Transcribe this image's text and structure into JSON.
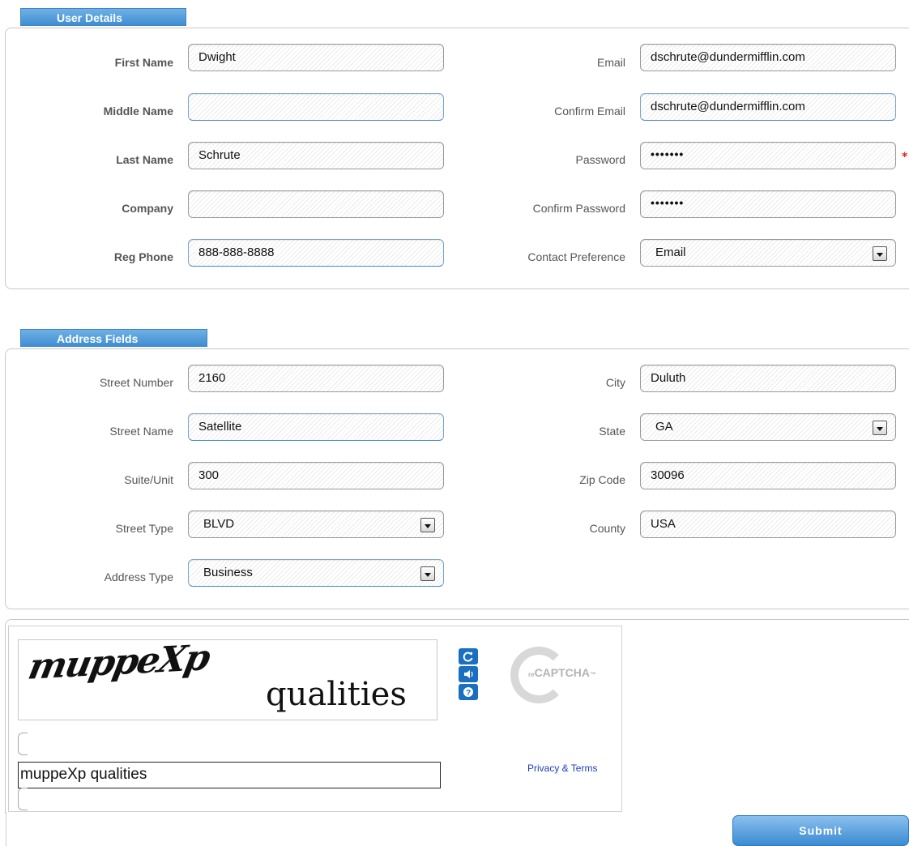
{
  "user_details": {
    "title": "User Details",
    "first_name": {
      "label": "First Name",
      "value": "Dwight"
    },
    "middle_name": {
      "label": "Middle Name",
      "value": ""
    },
    "last_name": {
      "label": "Last Name",
      "value": "Schrute"
    },
    "company": {
      "label": "Company",
      "value": ""
    },
    "reg_phone": {
      "label": "Reg Phone",
      "value": "888-888-8888"
    },
    "email": {
      "label": "Email",
      "value": "dschrute@dundermifflin.com"
    },
    "confirm_email": {
      "label": "Confirm Email",
      "value": "dschrute@dundermifflin.com"
    },
    "password": {
      "label": "Password",
      "value": "•••••••",
      "required_mark": "*"
    },
    "confirm_password": {
      "label": "Confirm Password",
      "value": "•••••••"
    },
    "contact_preference": {
      "label": "Contact Preference",
      "value": "Email"
    }
  },
  "address_fields": {
    "title": "Address Fields",
    "street_number": {
      "label": "Street Number",
      "value": "2160"
    },
    "street_name": {
      "label": "Street Name",
      "value": "Satellite"
    },
    "suite_unit": {
      "label": "Suite/Unit",
      "value": "300"
    },
    "street_type": {
      "label": "Street Type",
      "value": "BLVD"
    },
    "address_type": {
      "label": "Address Type",
      "value": "Business"
    },
    "city": {
      "label": "City",
      "value": "Duluth"
    },
    "state": {
      "label": "State",
      "value": "GA"
    },
    "zip_code": {
      "label": "Zip Code",
      "value": "30096"
    },
    "county": {
      "label": "County",
      "value": "USA"
    }
  },
  "captcha": {
    "image_word1": "muppeXp",
    "image_word2": "qualities",
    "response": "muppeXp qualities",
    "logo_prefix": "re",
    "logo_text": "CAPTCHA",
    "logo_tm": "™",
    "privacy_link": "Privacy & Terms",
    "icons": [
      "refresh-icon",
      "audio-icon",
      "help-icon"
    ]
  },
  "submit_label": "Submit",
  "colors": {
    "accent": "#3f8ed3",
    "required": "#dd2222",
    "link": "#1a3fb8"
  }
}
